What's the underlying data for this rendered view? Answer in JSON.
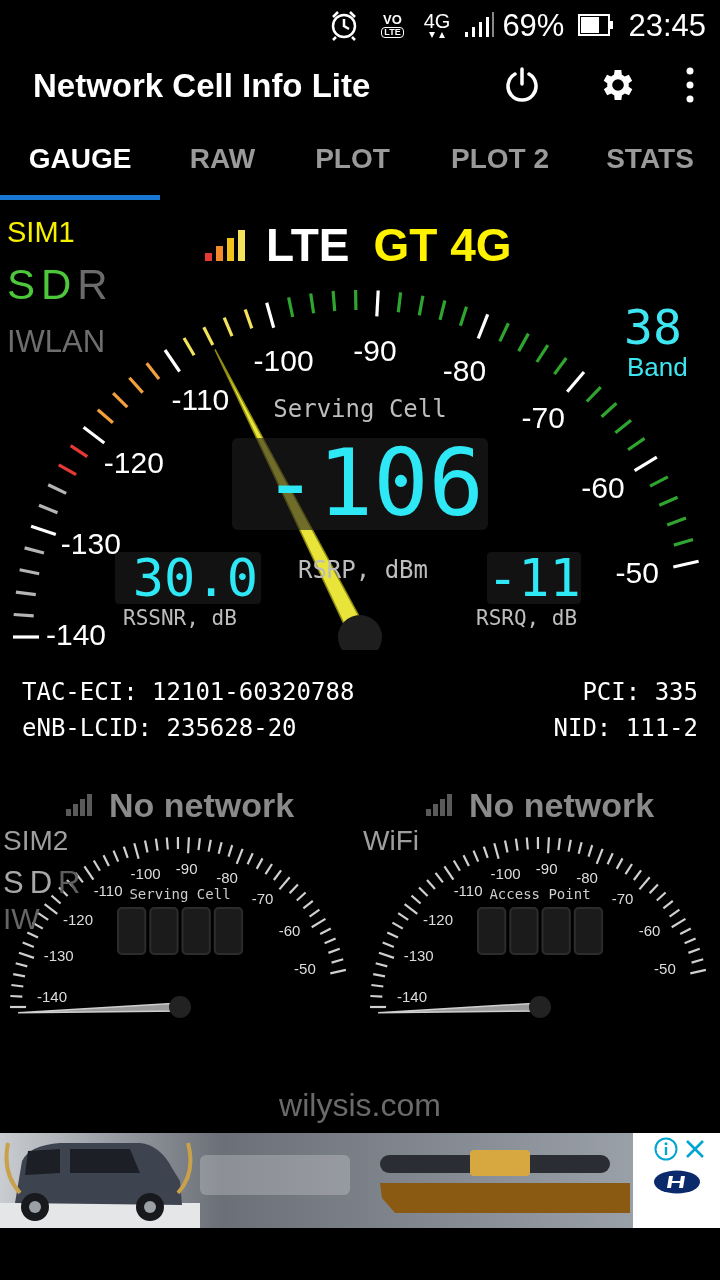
{
  "status_bar": {
    "volte_top": "VO",
    "volte_bottom": "LTE",
    "network_type": "4G",
    "battery": "69%",
    "time": "23:45"
  },
  "app_bar": {
    "title": "Network Cell Info Lite"
  },
  "tabs": [
    {
      "label": "GAUGE",
      "selected": true
    },
    {
      "label": "RAW",
      "selected": false
    },
    {
      "label": "PLOT",
      "selected": false
    },
    {
      "label": "PLOT 2",
      "selected": false
    },
    {
      "label": "STATS",
      "selected": false
    }
  ],
  "main_gauge": {
    "sim": "SIM1",
    "indicators": [
      {
        "label": "S",
        "active": true
      },
      {
        "label": "D",
        "active": true
      },
      {
        "label": "R",
        "active": false
      }
    ],
    "iwlan": "IWLAN",
    "technology": "LTE",
    "network_name": "GT 4G",
    "band_value": "38",
    "band_label": "Band",
    "scale_labels": [
      "-140",
      "-130",
      "-120",
      "-110",
      "-100",
      "-90",
      "-80",
      "-70",
      "-60",
      "-50"
    ],
    "title": "Serving Cell",
    "value": "-106",
    "unit": "RSRP, dBm",
    "rssnr_value": "30.0",
    "rssnr_label": "RSSNR, dB",
    "rsrq_value": "-11",
    "rsrq_label": "RSRQ, dB"
  },
  "cell_info": [
    {
      "left": "TAC-ECI: 12101-60320788",
      "right": "PCI: 335"
    },
    {
      "left": "eNB-LCID: 235628-20",
      "right": "NID: 111-2"
    }
  ],
  "mini_gauges": [
    {
      "status": "No network",
      "source": "SIM2",
      "indicators": [
        {
          "label": "S",
          "active": true
        },
        {
          "label": "D",
          "active": true
        },
        {
          "label": "R",
          "active": false
        }
      ],
      "iwlan": "IW",
      "title": "Serving Cell",
      "scale_labels": [
        "-140",
        "-130",
        "-120",
        "-110",
        "-100",
        "-90",
        "-80",
        "-70",
        "-60",
        "-50"
      ]
    },
    {
      "status": "No network",
      "source": "WiFi",
      "title": "Access Point",
      "scale_labels": [
        "-140",
        "-130",
        "-120",
        "-110",
        "-100",
        "-90",
        "-80",
        "-70",
        "-60",
        "-50"
      ]
    }
  ],
  "footer": "wilysis.com"
}
